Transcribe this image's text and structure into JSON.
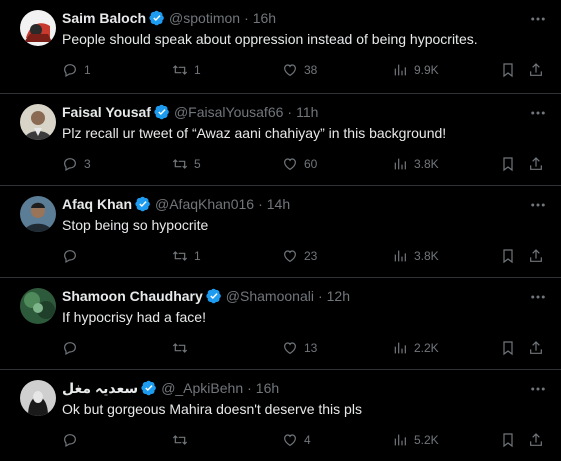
{
  "colors": {
    "background": "#000000",
    "text": "#e7e9ea",
    "muted": "#71767b",
    "verified": "#1d9bf0",
    "divider": "#2f3336"
  },
  "tweets": [
    {
      "name": "Saim Baloch",
      "handle": "@spotimon",
      "time": "16h",
      "text": "People should speak about oppression instead of being hypocrites.",
      "replies": "1",
      "retweets": "1",
      "likes": "38",
      "views": "9.9K"
    },
    {
      "name": "Faisal Yousaf",
      "handle": "@FaisalYousaf66",
      "time": "11h",
      "text": "Plz recall ur tweet of “Awaz aani chahiyay” in this background!",
      "replies": "3",
      "retweets": "5",
      "likes": "60",
      "views": "3.8K"
    },
    {
      "name": "Afaq Khan",
      "handle": "@AfaqKhan016",
      "time": "14h",
      "text": "Stop being so hypocrite",
      "replies": "",
      "retweets": "1",
      "likes": "23",
      "views": "3.8K"
    },
    {
      "name": "Shamoon Chaudhary",
      "handle": "@Shamoonali",
      "time": "12h",
      "text": "If hypocrisy had a face!",
      "replies": "",
      "retweets": "",
      "likes": "13",
      "views": "2.2K"
    },
    {
      "name": "سعدیہ مغل",
      "handle": "@_ApkiBehn",
      "time": "16h",
      "text": "Ok but  gorgeous Mahira doesn't deserve this pls",
      "replies": "",
      "retweets": "",
      "likes": "4",
      "views": "5.2K"
    }
  ],
  "icons": {
    "dot": "·",
    "verified": "verified-badge-icon",
    "more": "more-dots-icon",
    "reply": "reply-icon",
    "retweet": "retweet-icon",
    "like": "heart-icon",
    "views": "views-icon",
    "bookmark": "bookmark-icon",
    "share": "share-icon"
  }
}
